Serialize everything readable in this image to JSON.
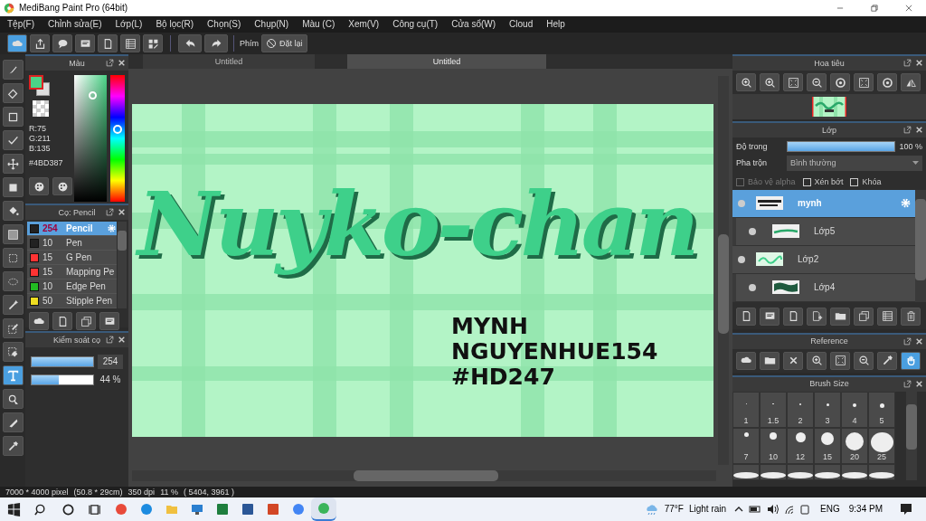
{
  "window": {
    "title": "MediBang Paint Pro (64bit)"
  },
  "menu": [
    "Tệp(F)",
    "Chỉnh sửa(E)",
    "Lớp(L)",
    "Bộ lọc(R)",
    "Chọn(S)",
    "Chụp(N)",
    "Màu (C)",
    "Xem(V)",
    "Công cụ(T)",
    "Cửa sổ(W)",
    "Cloud",
    "Help"
  ],
  "toolbar": {
    "shortcut_label": "Phím",
    "reset_button": "Đặt lại"
  },
  "tools": [
    {
      "kind": "brush",
      "selected": false
    },
    {
      "kind": "eraser",
      "selected": false
    },
    {
      "kind": "dot",
      "selected": false
    },
    {
      "kind": "polyline",
      "selected": false
    },
    {
      "kind": "move",
      "selected": false
    },
    {
      "kind": "fill",
      "selected": false
    },
    {
      "kind": "bucket",
      "selected": false
    },
    {
      "kind": "gradient",
      "selected": false
    },
    {
      "kind": "select",
      "selected": false
    },
    {
      "kind": "lasso",
      "selected": false
    },
    {
      "kind": "wand",
      "selected": false
    },
    {
      "kind": "selectpen",
      "selected": false
    },
    {
      "kind": "selecteraser",
      "selected": false
    },
    {
      "kind": "text",
      "selected": true
    },
    {
      "kind": "operation",
      "selected": false
    },
    {
      "kind": "divide",
      "selected": false
    },
    {
      "kind": "dropper",
      "selected": false
    }
  ],
  "color_panel": {
    "title": "Màu",
    "r": "R:75",
    "g": "G:211",
    "b": "B:135",
    "hex": "#4BD387",
    "hue": {
      "level": 0.57
    }
  },
  "brush_panel": {
    "title": "Cọ: Pencil",
    "brushes": [
      {
        "size": "254",
        "name": "Pencil",
        "color": "#222222",
        "selected": true
      },
      {
        "size": "10",
        "name": "Pen",
        "color": "#222222",
        "selected": false
      },
      {
        "size": "15",
        "name": "G Pen",
        "color": "#ff3333",
        "selected": false
      },
      {
        "size": "15",
        "name": "Mapping Pe",
        "color": "#ff3333",
        "selected": false
      },
      {
        "size": "10",
        "name": "Edge Pen",
        "color": "#22bb22",
        "selected": false
      },
      {
        "size": "50",
        "name": "Stipple Pen",
        "color": "#eedd22",
        "selected": false
      }
    ]
  },
  "brush_control": {
    "title": "Kiểm soát cọ",
    "size": {
      "level": 1,
      "reading": "254"
    },
    "opacity": {
      "level": 0.44,
      "reading": "44 %"
    }
  },
  "canvas": {
    "tabs": [
      {
        "label": "Untitled",
        "selected": false
      },
      {
        "label": "Untitled",
        "selected": true
      }
    ],
    "lettering": "Nuyko-chan",
    "lines": [
      "MYNH",
      "NGUYENHUE154",
      "#HD247"
    ]
  },
  "navigator": {
    "title": "Hoa tiêu"
  },
  "layers_panel": {
    "title": "Lớp",
    "opacity_label": "Độ trong",
    "opacity": {
      "level": 1,
      "reading": "100 %"
    },
    "blend_label": "Pha trộn",
    "blend_mode": "Bình thường",
    "options": [
      {
        "label": "Bảo vệ alpha",
        "checked": false,
        "disabled": true
      },
      {
        "label": "Xén bớt",
        "checked": false,
        "disabled": false
      },
      {
        "label": "Khóa",
        "checked": false,
        "disabled": false
      }
    ],
    "layers": [
      {
        "name": "mynh",
        "selected": true,
        "clipped": false,
        "kind": "text"
      },
      {
        "name": "Lớp5",
        "selected": false,
        "clipped": true,
        "kind": "stroke"
      },
      {
        "name": "Lớp2",
        "selected": false,
        "clipped": false,
        "kind": "lettering"
      },
      {
        "name": "Lớp4",
        "selected": false,
        "clipped": true,
        "kind": "blob"
      }
    ]
  },
  "reference": {
    "title": "Reference",
    "tools": [
      {
        "kind": "cloud",
        "selected": false
      },
      {
        "kind": "folder",
        "selected": false
      },
      {
        "kind": "close",
        "selected": false
      },
      {
        "kind": "zoomin",
        "selected": false
      },
      {
        "kind": "fit",
        "selected": false
      },
      {
        "kind": "zoomout",
        "selected": false
      },
      {
        "kind": "dropper",
        "selected": false
      },
      {
        "kind": "hand",
        "selected": true
      }
    ]
  },
  "brush_size": {
    "title": "Brush Size",
    "sizes": [
      "1",
      "1.5",
      "2",
      "3",
      "4",
      "5",
      "7",
      "10",
      "12",
      "15",
      "20",
      "25"
    ]
  },
  "status_bar": [
    "7000 * 4000 pixel",
    "(50.8 * 29cm)",
    "350 dpi",
    "11 %",
    "( 5404, 3961 )"
  ],
  "taskbar": {
    "temperature": "77°F",
    "weather": "Light rain",
    "language": "ENG",
    "time": "9:34 PM"
  }
}
